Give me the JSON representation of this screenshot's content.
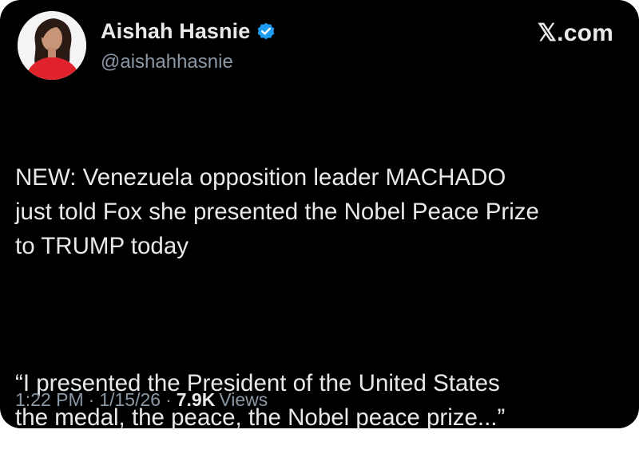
{
  "author": {
    "display_name": "Aishah Hasnie",
    "handle": "@aishahhasnie",
    "verified_icon": "verified-badge-icon",
    "avatar_icon": "profile-photo"
  },
  "brand": {
    "label": "𝕏.com"
  },
  "tweet": {
    "paragraph_1": "NEW: Venezuela opposition leader MACHADO\njust told Fox she presented the Nobel Peace Prize\nto TRUMP today",
    "paragraph_2": "“I presented the President of the United States\nthe medal, the peace, the Nobel peace prize...”"
  },
  "meta": {
    "time": "1:22 PM",
    "separator": "·",
    "date": "1/15/26",
    "views_count": "7.9K",
    "views_label": "Views"
  },
  "colors": {
    "background": "#000000",
    "primary_text": "#e7e9ea",
    "secondary_text": "#8b98a5",
    "verified_blue": "#1d9bf0",
    "avatar_dress": "#e0222c"
  }
}
